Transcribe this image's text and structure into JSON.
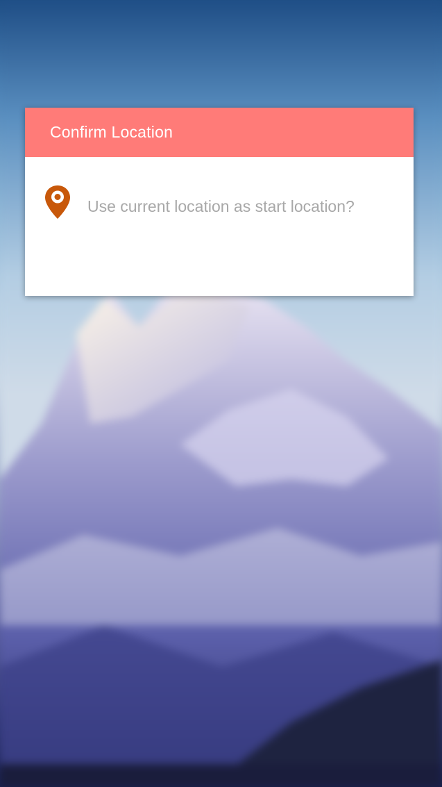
{
  "background": {
    "description_icon": "mountain-background"
  },
  "dialog": {
    "title": "Confirm Location",
    "message": "Use current location as start location?",
    "icon": "location-pin-icon",
    "header_color": "#ff7b78",
    "icon_color": "#c8580a"
  }
}
